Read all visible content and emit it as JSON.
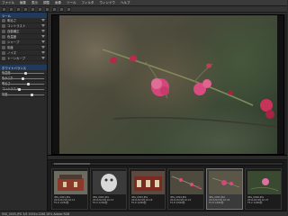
{
  "menu": {
    "items": [
      "ファイル",
      "編集",
      "表示",
      "調整",
      "画像",
      "ツール",
      "フィルタ",
      "ウィンドウ",
      "ヘルプ"
    ]
  },
  "left_panel": {
    "section_heading": "ツール",
    "rows": [
      "明るさ",
      "コントラスト",
      "自動補正",
      "色温度",
      "シャープ",
      "彩度",
      "ノイズ",
      "トーンカーブ"
    ],
    "subheading": "ホワイトバランス",
    "sliders": [
      {
        "label": "色温度",
        "value": 0.55
      },
      {
        "label": "色かぶり",
        "value": 0.48
      },
      {
        "label": "明るさ",
        "value": 0.62
      },
      {
        "label": "コントラスト",
        "value": 0.4
      },
      {
        "label": "彩度",
        "value": 0.7
      }
    ]
  },
  "thumbnails": [
    {
      "caption1": "IMG_0001.JPG",
      "caption2": "2011/02/18 10:12",
      "caption3": "F5.6 1/250秒"
    },
    {
      "caption1": "IMG_0002.JPG",
      "caption2": "2011/02/18 10:15",
      "caption3": "F4.0 1/320秒"
    },
    {
      "caption1": "IMG_0003.JPG",
      "caption2": "2011/02/18 10:18",
      "caption3": "F5.6 1/200秒"
    },
    {
      "caption1": "IMG_0004.JPG",
      "caption2": "2011/02/18 10:21",
      "caption3": "F2.8 1/500秒"
    },
    {
      "caption1": "IMG_0005.JPG",
      "caption2": "2011/02/18 10:24",
      "caption3": "F2.8 1/640秒"
    },
    {
      "caption1": "IMG_0006.JPG",
      "caption2": "2011/02/18 10:27",
      "caption3": "F3.2 1/400秒"
    }
  ],
  "status": {
    "text": "IMG_0005.JPG  3/6  1936×1288  28%  Adobe RGB"
  },
  "colors": {
    "accent": "#1f3a5c",
    "selection": "#777777"
  }
}
